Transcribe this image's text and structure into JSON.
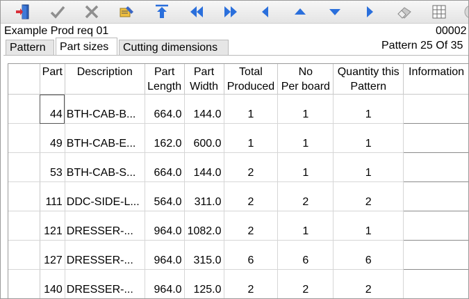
{
  "toolbar": {
    "icons": [
      "exit-door-icon",
      "check-icon",
      "cancel-icon",
      "edit-pen-icon",
      "up-to-top-icon",
      "first-icon",
      "last-icon",
      "previous-icon",
      "up-icon",
      "down-icon",
      "next-icon",
      "eraser-icon",
      "grid-icon"
    ]
  },
  "header": {
    "title": "Example Prod req 01",
    "code": "00002",
    "pattern_status": "Pattern 25 Of 35"
  },
  "tabs": [
    {
      "label": "Pattern"
    },
    {
      "label": "Part sizes"
    },
    {
      "label": "Cutting dimensions"
    }
  ],
  "table": {
    "columns": [
      {
        "line1": "",
        "line2": ""
      },
      {
        "line1": "Part",
        "line2": ""
      },
      {
        "line1": "Description",
        "line2": ""
      },
      {
        "line1": "Part",
        "line2": "Length"
      },
      {
        "line1": "Part",
        "line2": "Width"
      },
      {
        "line1": "Total",
        "line2": "Produced"
      },
      {
        "line1": "No",
        "line2": "Per board"
      },
      {
        "line1": "Quantity this",
        "line2": "Pattern"
      },
      {
        "line1": "Information",
        "line2": ""
      }
    ],
    "rows": [
      {
        "part": "44",
        "description": "BTH-CAB-B...",
        "length": "664.0",
        "width": "144.0",
        "produced": "1",
        "per_board": "1",
        "qty": "1"
      },
      {
        "part": "49",
        "description": "BTH-CAB-E...",
        "length": "162.0",
        "width": "600.0",
        "produced": "1",
        "per_board": "1",
        "qty": "1"
      },
      {
        "part": "53",
        "description": "BTH-CAB-S...",
        "length": "664.0",
        "width": "144.0",
        "produced": "2",
        "per_board": "1",
        "qty": "1"
      },
      {
        "part": "111",
        "description": "DDC-SIDE-L...",
        "length": "564.0",
        "width": "311.0",
        "produced": "2",
        "per_board": "2",
        "qty": "2"
      },
      {
        "part": "121",
        "description": "DRESSER-...",
        "length": "964.0",
        "width": "1082.0",
        "produced": "2",
        "per_board": "1",
        "qty": "1"
      },
      {
        "part": "127",
        "description": "DRESSER-...",
        "length": "964.0",
        "width": "315.0",
        "produced": "6",
        "per_board": "6",
        "qty": "6"
      },
      {
        "part": "140",
        "description": "DRESSER-...",
        "length": "964.0",
        "width": "125.0",
        "produced": "2",
        "per_board": "2",
        "qty": "2"
      }
    ]
  }
}
